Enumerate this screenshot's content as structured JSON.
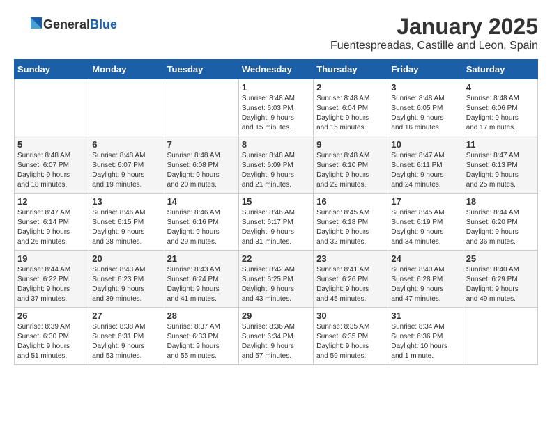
{
  "logo": {
    "general": "General",
    "blue": "Blue"
  },
  "title": "January 2025",
  "location": "Fuentespreadas, Castille and Leon, Spain",
  "days_header": [
    "Sunday",
    "Monday",
    "Tuesday",
    "Wednesday",
    "Thursday",
    "Friday",
    "Saturday"
  ],
  "weeks": [
    [
      {
        "day": "",
        "info": ""
      },
      {
        "day": "",
        "info": ""
      },
      {
        "day": "",
        "info": ""
      },
      {
        "day": "1",
        "info": "Sunrise: 8:48 AM\nSunset: 6:03 PM\nDaylight: 9 hours\nand 15 minutes."
      },
      {
        "day": "2",
        "info": "Sunrise: 8:48 AM\nSunset: 6:04 PM\nDaylight: 9 hours\nand 15 minutes."
      },
      {
        "day": "3",
        "info": "Sunrise: 8:48 AM\nSunset: 6:05 PM\nDaylight: 9 hours\nand 16 minutes."
      },
      {
        "day": "4",
        "info": "Sunrise: 8:48 AM\nSunset: 6:06 PM\nDaylight: 9 hours\nand 17 minutes."
      }
    ],
    [
      {
        "day": "5",
        "info": "Sunrise: 8:48 AM\nSunset: 6:07 PM\nDaylight: 9 hours\nand 18 minutes."
      },
      {
        "day": "6",
        "info": "Sunrise: 8:48 AM\nSunset: 6:07 PM\nDaylight: 9 hours\nand 19 minutes."
      },
      {
        "day": "7",
        "info": "Sunrise: 8:48 AM\nSunset: 6:08 PM\nDaylight: 9 hours\nand 20 minutes."
      },
      {
        "day": "8",
        "info": "Sunrise: 8:48 AM\nSunset: 6:09 PM\nDaylight: 9 hours\nand 21 minutes."
      },
      {
        "day": "9",
        "info": "Sunrise: 8:48 AM\nSunset: 6:10 PM\nDaylight: 9 hours\nand 22 minutes."
      },
      {
        "day": "10",
        "info": "Sunrise: 8:47 AM\nSunset: 6:11 PM\nDaylight: 9 hours\nand 24 minutes."
      },
      {
        "day": "11",
        "info": "Sunrise: 8:47 AM\nSunset: 6:13 PM\nDaylight: 9 hours\nand 25 minutes."
      }
    ],
    [
      {
        "day": "12",
        "info": "Sunrise: 8:47 AM\nSunset: 6:14 PM\nDaylight: 9 hours\nand 26 minutes."
      },
      {
        "day": "13",
        "info": "Sunrise: 8:46 AM\nSunset: 6:15 PM\nDaylight: 9 hours\nand 28 minutes."
      },
      {
        "day": "14",
        "info": "Sunrise: 8:46 AM\nSunset: 6:16 PM\nDaylight: 9 hours\nand 29 minutes."
      },
      {
        "day": "15",
        "info": "Sunrise: 8:46 AM\nSunset: 6:17 PM\nDaylight: 9 hours\nand 31 minutes."
      },
      {
        "day": "16",
        "info": "Sunrise: 8:45 AM\nSunset: 6:18 PM\nDaylight: 9 hours\nand 32 minutes."
      },
      {
        "day": "17",
        "info": "Sunrise: 8:45 AM\nSunset: 6:19 PM\nDaylight: 9 hours\nand 34 minutes."
      },
      {
        "day": "18",
        "info": "Sunrise: 8:44 AM\nSunset: 6:20 PM\nDaylight: 9 hours\nand 36 minutes."
      }
    ],
    [
      {
        "day": "19",
        "info": "Sunrise: 8:44 AM\nSunset: 6:22 PM\nDaylight: 9 hours\nand 37 minutes."
      },
      {
        "day": "20",
        "info": "Sunrise: 8:43 AM\nSunset: 6:23 PM\nDaylight: 9 hours\nand 39 minutes."
      },
      {
        "day": "21",
        "info": "Sunrise: 8:43 AM\nSunset: 6:24 PM\nDaylight: 9 hours\nand 41 minutes."
      },
      {
        "day": "22",
        "info": "Sunrise: 8:42 AM\nSunset: 6:25 PM\nDaylight: 9 hours\nand 43 minutes."
      },
      {
        "day": "23",
        "info": "Sunrise: 8:41 AM\nSunset: 6:26 PM\nDaylight: 9 hours\nand 45 minutes."
      },
      {
        "day": "24",
        "info": "Sunrise: 8:40 AM\nSunset: 6:28 PM\nDaylight: 9 hours\nand 47 minutes."
      },
      {
        "day": "25",
        "info": "Sunrise: 8:40 AM\nSunset: 6:29 PM\nDaylight: 9 hours\nand 49 minutes."
      }
    ],
    [
      {
        "day": "26",
        "info": "Sunrise: 8:39 AM\nSunset: 6:30 PM\nDaylight: 9 hours\nand 51 minutes."
      },
      {
        "day": "27",
        "info": "Sunrise: 8:38 AM\nSunset: 6:31 PM\nDaylight: 9 hours\nand 53 minutes."
      },
      {
        "day": "28",
        "info": "Sunrise: 8:37 AM\nSunset: 6:33 PM\nDaylight: 9 hours\nand 55 minutes."
      },
      {
        "day": "29",
        "info": "Sunrise: 8:36 AM\nSunset: 6:34 PM\nDaylight: 9 hours\nand 57 minutes."
      },
      {
        "day": "30",
        "info": "Sunrise: 8:35 AM\nSunset: 6:35 PM\nDaylight: 9 hours\nand 59 minutes."
      },
      {
        "day": "31",
        "info": "Sunrise: 8:34 AM\nSunset: 6:36 PM\nDaylight: 10 hours\nand 1 minute."
      },
      {
        "day": "",
        "info": ""
      }
    ]
  ]
}
